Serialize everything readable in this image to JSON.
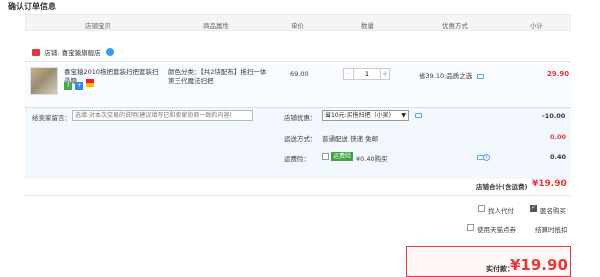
{
  "page": {
    "title": "确认订单信息"
  },
  "columns": [
    "店铺宝贝",
    "商品属性",
    "单价",
    "数量",
    "优惠方式",
    "小计"
  ],
  "store": {
    "label": "店铺:",
    "name": "喜宝猿旗舰店"
  },
  "item": {
    "title": "喜宝猿2010拖把套装扫把套装扫帚簸...",
    "attr": "颜色分类：【共2块配布】拖扫一体第三代魔法扫把",
    "tags": [
      "7",
      "+"
    ],
    "unit_price": "69.00",
    "quantity": "1",
    "qty_minus": "-",
    "qty_plus": "+",
    "discount": "省39.10:品质之选",
    "subtotal": "29.90"
  },
  "memo": {
    "label": "给卖家留言：",
    "placeholder": "选填:对本次交易的说明(建议填写已和卖家协商一致的内容)"
  },
  "coupon": {
    "label": "店铺优惠：",
    "selected": "省10元:买拖扫把（小吴）",
    "value": "-10.00"
  },
  "shipping": {
    "label": "运送方式：",
    "text": "普通配送 快递 免邮",
    "value": "0.00"
  },
  "insurance": {
    "label": "运费险：",
    "badge": "运费险",
    "price": "¥0.40购买",
    "value": "0.40"
  },
  "store_total": {
    "label": "店铺合计(含运费)",
    "value": "¥19.90"
  },
  "options": {
    "friend_pay": "找人代付",
    "anonymous": "匿名购买",
    "tmall_points": "使用天猫点券",
    "settle_now": "结算时抵扣"
  },
  "total": {
    "label": "实付款：",
    "value": "¥19.90"
  },
  "colors": {
    "accent": "#e4393c",
    "link": "#3a9cf0"
  }
}
